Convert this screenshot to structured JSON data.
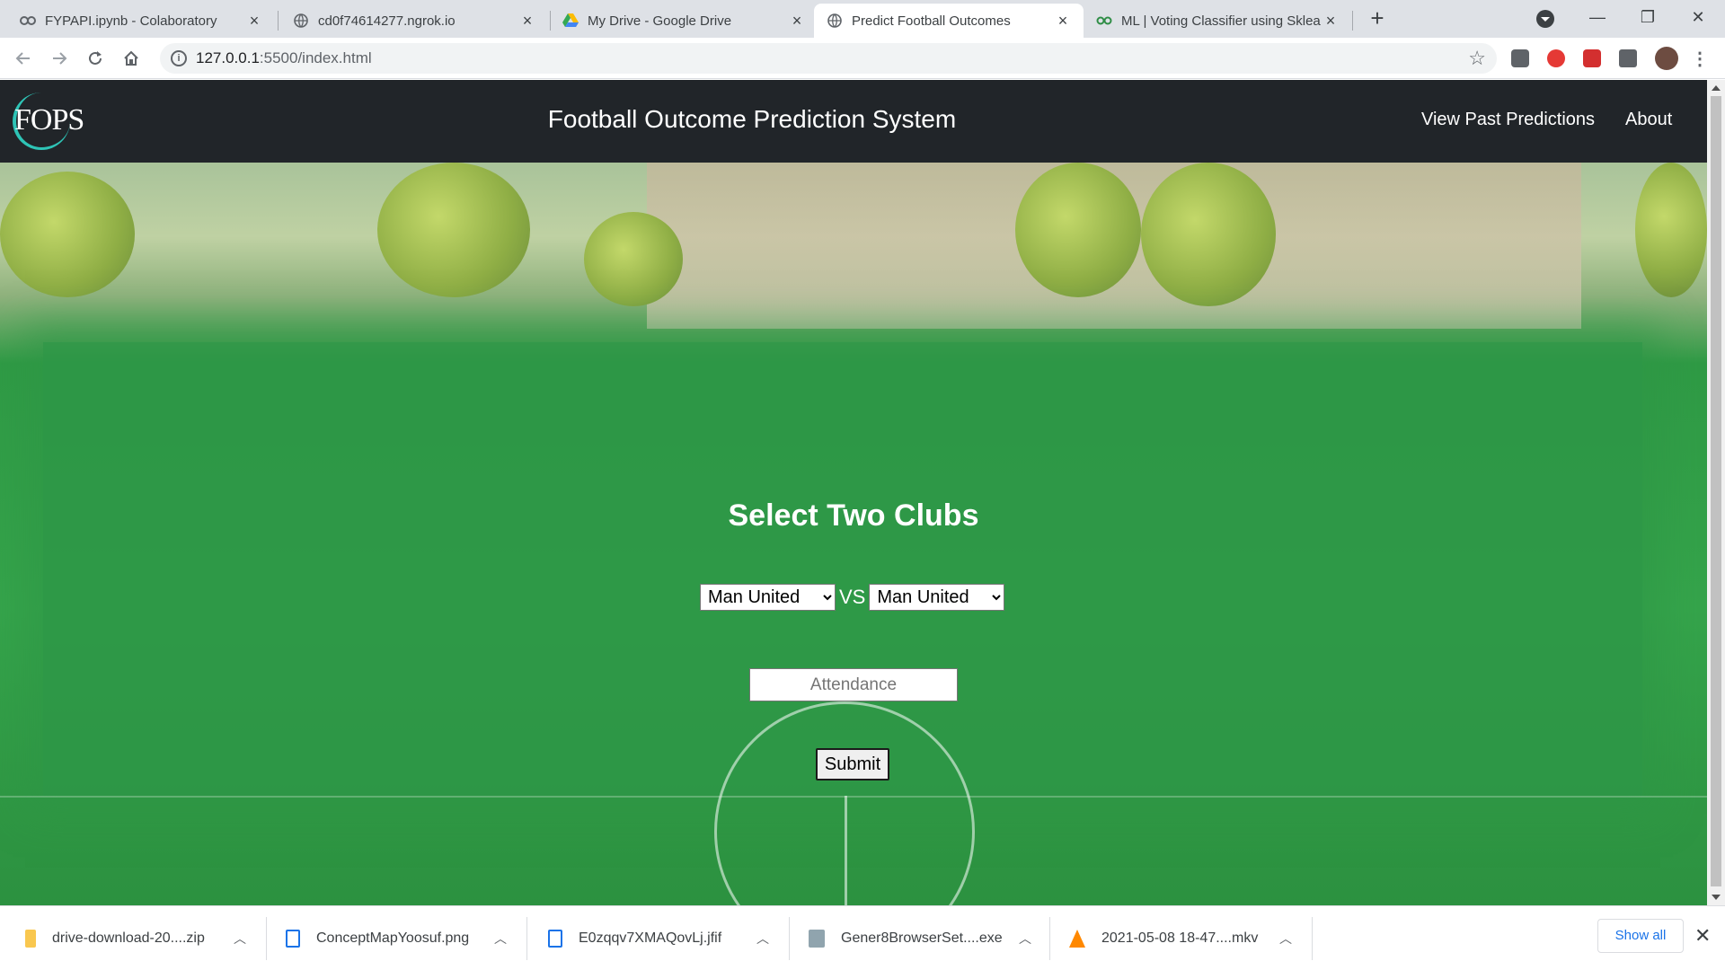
{
  "browser": {
    "tabs": [
      {
        "title": "FYPAPI.ipynb - Colaboratory",
        "icon": "colab-icon",
        "active": false
      },
      {
        "title": "cd0f74614277.ngrok.io",
        "icon": "globe-icon",
        "active": false
      },
      {
        "title": "My Drive - Google Drive",
        "icon": "google-drive-icon",
        "active": false
      },
      {
        "title": "Predict Football Outcomes",
        "icon": "globe-icon",
        "active": true
      },
      {
        "title": "ML | Voting Classifier using Sklea",
        "icon": "geeksforgeeks-icon",
        "active": false
      }
    ],
    "url_host": "127.0.0.1",
    "url_rest": ":5500/index.html"
  },
  "site": {
    "logo_text": "FOPS",
    "title": "Football Outcome Prediction System",
    "nav": [
      "View Past Predictions",
      "About"
    ]
  },
  "form": {
    "heading": "Select Two Clubs",
    "home_club": "Man United",
    "away_club": "Man United",
    "vs_label": "VS",
    "attendance_placeholder": "Attendance",
    "submit_label": "Submit"
  },
  "downloads": {
    "items": [
      {
        "name": "drive-download-20....zip",
        "icon": "zip-file-icon"
      },
      {
        "name": "ConceptMapYoosuf.png",
        "icon": "image-file-icon"
      },
      {
        "name": "E0zqqv7XMAQovLj.jfif",
        "icon": "image-file-icon"
      },
      {
        "name": "Gener8BrowserSet....exe",
        "icon": "installer-icon"
      },
      {
        "name": "2021-05-08 18-47....mkv",
        "icon": "vlc-icon"
      }
    ],
    "show_all_label": "Show all"
  }
}
